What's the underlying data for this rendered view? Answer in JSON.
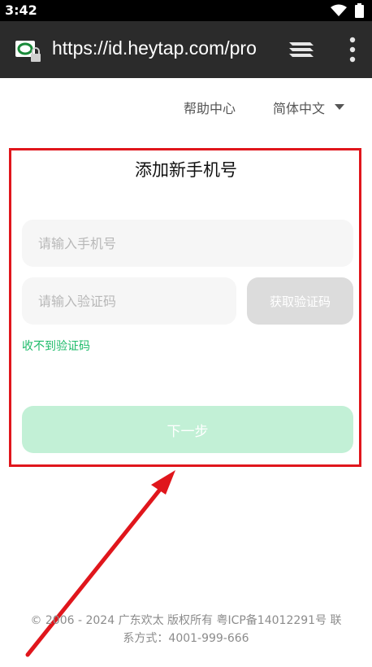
{
  "status_bar": {
    "time": "3:42"
  },
  "browser": {
    "url": "https://id.heytap.com/pro"
  },
  "header": {
    "help_label": "帮助中心",
    "language_label": "简体中文"
  },
  "form": {
    "title": "添加新手机号",
    "phone_placeholder": "请输入手机号",
    "code_placeholder": "请输入验证码",
    "get_code_label": "获取验证码",
    "no_code_link": "收不到验证码",
    "next_label": "下一步"
  },
  "footer": {
    "line1": "© 2006 - 2024 广东欢太 版权所有 粤ICP备14012291号 联",
    "line2": "系方式：4001-999-666"
  },
  "colors": {
    "accent_green": "#1dbb6a",
    "next_button_disabled": "#c2f0d6",
    "annotation_red": "#e0161c"
  }
}
